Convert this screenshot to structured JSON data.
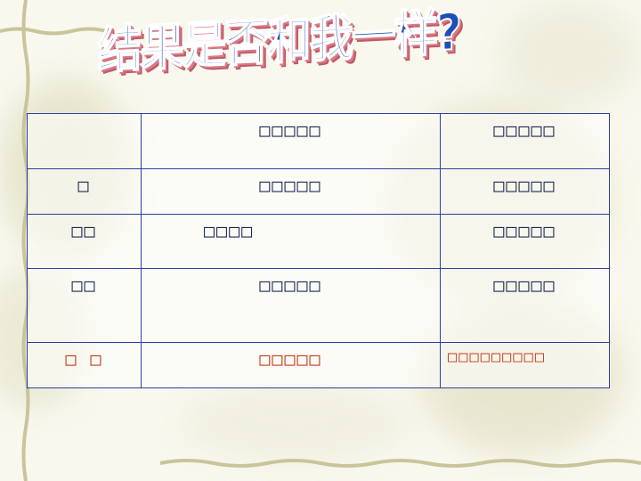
{
  "title": "结果是否和我一样?",
  "table": {
    "rows": [
      [
        "",
        "□□□□□",
        "□□□□□"
      ],
      [
        "□",
        "□□□□□",
        "□□□□□"
      ],
      [
        "□□",
        "□□□□",
        "□□□□□"
      ],
      [
        "□□",
        "□□□□□",
        "□□□□□"
      ],
      [
        "□ □",
        "□□□□□",
        "□□□□□□□□□"
      ]
    ]
  },
  "colors": {
    "title_fill": "#1d4fb8",
    "title_shadow": "#d97b86",
    "table_border": "#2f3fa0",
    "highlight_row": "#c43c1c"
  }
}
